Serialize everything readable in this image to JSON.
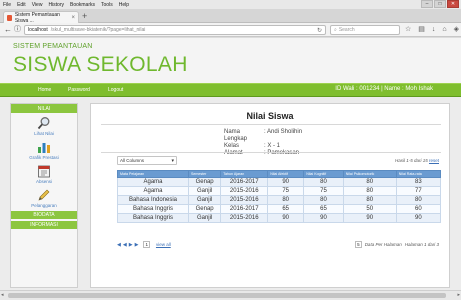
{
  "browser": {
    "menu": [
      "File",
      "Edit",
      "View",
      "History",
      "Bookmarks",
      "Tools",
      "Help"
    ],
    "tab_title": "Sistem Pemantauan Siswa ...",
    "tab_close": "×",
    "new_tab": "+",
    "url_host": "localhost",
    "url_path": "/skul_multisave-bkiatenik/?page=lihat_nilai",
    "search_placeholder": "Search"
  },
  "header": {
    "subtitle": "SISTEM PEMANTAUAN",
    "title": "SISWA SEKOLAH"
  },
  "topnav": {
    "items": [
      "Home",
      "Password",
      "Logout"
    ],
    "user_info": "ID Wali : 001234 | Name : Moh Ishak"
  },
  "sidebar": {
    "header": "NILAI",
    "items": [
      {
        "label": "Lihat Nilai",
        "icon": "search-magnifier-icon"
      },
      {
        "label": "Grafik Prestasi",
        "icon": "bar-chart-icon"
      },
      {
        "label": "Absensi",
        "icon": "calendar-icon"
      },
      {
        "label": "Pelanggaran",
        "icon": "pencil-icon"
      }
    ],
    "footer": [
      "BIODATA",
      "INFORMASI"
    ]
  },
  "main": {
    "title": "Nilai Siswa",
    "info": [
      {
        "label": "Nama Lengkap",
        "value": ": Andi Sholihin"
      },
      {
        "label": "Kelas",
        "value": ": X - 1"
      },
      {
        "label": "Alamat",
        "value": ": Pamekasan"
      }
    ],
    "filter_value": "All Columns",
    "hasil": "Hasil 1-5 dari 15",
    "reset": "reset",
    "columns": [
      "Mata Pelajaran",
      "Semester",
      "Tahun Ajaran",
      "Nilai Afektif",
      "Nilai Kognitif",
      "Nilai Psikomotorik",
      "Nilai Rata-rata"
    ],
    "rows": [
      [
        "Agama",
        "Genap",
        "2016-2017",
        "90",
        "80",
        "80",
        "83"
      ],
      [
        "Agama",
        "Ganjil",
        "2015-2016",
        "75",
        "75",
        "80",
        "77"
      ],
      [
        "Bahasa Indonesia",
        "Ganjil",
        "2015-2016",
        "80",
        "80",
        "80",
        "80"
      ],
      [
        "Bahasa Inggris",
        "Genap",
        "2016-2017",
        "65",
        "65",
        "50",
        "60"
      ],
      [
        "Bahasa Inggris",
        "Ganjil",
        "2015-2016",
        "90",
        "90",
        "90",
        "90"
      ]
    ],
    "pager_first": "◀",
    "pager_prev": "◀",
    "pager_next": "▶",
    "pager_last": "▶",
    "pager_select": "1",
    "view_all": "view all",
    "per_page_value": "5",
    "per_page_label": "Data Per Halaman",
    "page_info": "Halaman 1 dari 3"
  },
  "colors": {
    "brand_green": "#6fb82e",
    "nav_green": "#7fbe2e",
    "table_header_blue": "#6a9bd1"
  }
}
